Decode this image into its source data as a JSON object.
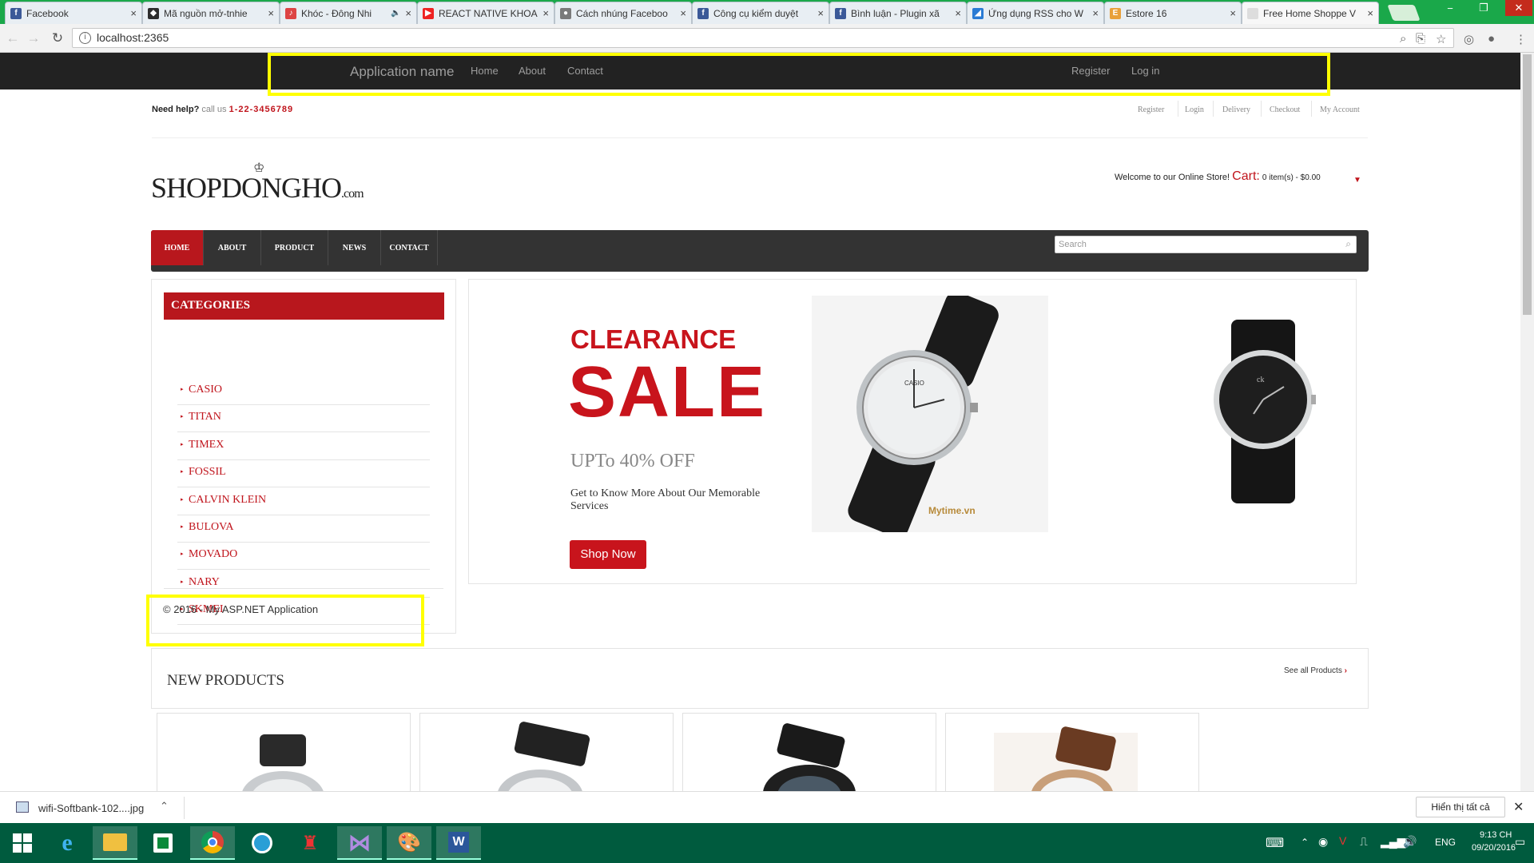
{
  "browser": {
    "tabs": [
      {
        "label": "Facebook",
        "favicon": "facebook-icon",
        "color": "#3b5998",
        "glyph": "f"
      },
      {
        "label": "Mã nguồn mở-tnhie",
        "favicon": "github-icon",
        "color": "#2d2d2d",
        "glyph": "◆"
      },
      {
        "label": "Khóc - Đông Nhi",
        "favicon": "music-icon",
        "color": "#d44",
        "glyph": "♪",
        "audio": "🔈"
      },
      {
        "label": "REACT NATIVE KHOA",
        "favicon": "youtube-icon",
        "color": "#e22",
        "glyph": "▶"
      },
      {
        "label": "Cách nhúng Faceboo",
        "favicon": "avatar-icon",
        "color": "#7a7a7a",
        "glyph": "●"
      },
      {
        "label": "Công cụ kiểm duyệt",
        "favicon": "facebook-icon",
        "color": "#3b5998",
        "glyph": "f"
      },
      {
        "label": "Bình luận - Plugin xã",
        "favicon": "facebook-icon",
        "color": "#3b5998",
        "glyph": "f"
      },
      {
        "label": "Ứng dụng RSS cho W",
        "favicon": "rss-icon",
        "color": "#2a7bd4",
        "glyph": "◢"
      },
      {
        "label": "Estore 16",
        "favicon": "estore-icon",
        "color": "#e8a03a",
        "glyph": "E"
      },
      {
        "label": "Free Home Shoppe V",
        "favicon": "page-icon",
        "color": "#ddd",
        "glyph": ""
      }
    ],
    "close_glyph": "×",
    "url": "localhost:2365",
    "window_buttons": [
      "−",
      "❐",
      "✕"
    ]
  },
  "aspnet_nav": {
    "brand": "Application name",
    "links": [
      "Home",
      "About",
      "Contact"
    ],
    "right_links": [
      "Register",
      "Log in"
    ]
  },
  "topbar": {
    "help_label": "Need help?",
    "call_label": "call us",
    "phone": "1-22-3456789",
    "links": [
      "Register",
      "Login",
      "Delivery",
      "Checkout",
      "My Account"
    ]
  },
  "logo": {
    "main": "SHOPDONGHO",
    "suffix": ".com"
  },
  "cart": {
    "welcome": "Welcome to our Online Store!",
    "label": "Cart:",
    "summary": "0 item(s) - $0.00"
  },
  "main_nav": {
    "items": [
      "HOME",
      "ABOUT",
      "PRODUCT",
      "NEWS",
      "CONTACT"
    ],
    "search_placeholder": "Search"
  },
  "categories": {
    "title": "CATEGORIES",
    "items": [
      "CASIO",
      "TITAN",
      "TIMEX",
      "FOSSIL",
      "CALVIN KLEIN",
      "BULOVA",
      "MOVADO",
      "NARY",
      "SKMEI"
    ]
  },
  "footer": {
    "copyright": "© 2016 - My ASP.NET Application"
  },
  "banner": {
    "headline": "CLEARANCE",
    "big": "SALE",
    "offer": "UPTo 40% OFF",
    "description": "Get to Know More About Our Memorable Services",
    "button": "Shop Now",
    "watch_brand": "CASIO",
    "watermark": "Mytime.vn"
  },
  "new_products": {
    "title": "NEW PRODUCTS",
    "see_all": "See all Products"
  },
  "download_bar": {
    "file": "wifi-Softbank-102....jpg",
    "show_all": "Hiển thị tất cả"
  },
  "taskbar": {
    "lang": "ENG",
    "time": "9:13 CH",
    "date": "09/20/2016"
  },
  "colors": {
    "brand_red": "#b8171d",
    "tab_green": "#1aa84a",
    "highlight": "#ffff00",
    "taskbar": "#005b3e"
  }
}
